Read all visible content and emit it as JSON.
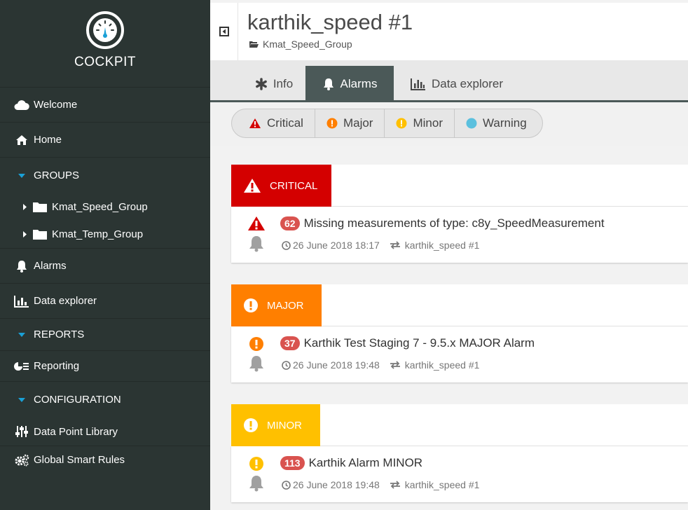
{
  "sidebar": {
    "brand": "COCKPIT",
    "items": [
      {
        "label": "Welcome",
        "icon": "cloud-icon"
      },
      {
        "label": "Home",
        "icon": "home-icon"
      },
      {
        "label": "GROUPS",
        "icon": "caret-down-icon"
      },
      {
        "label": "Kmat_Speed_Group",
        "icon": "folder-icon"
      },
      {
        "label": "Kmat_Temp_Group",
        "icon": "folder-icon"
      },
      {
        "label": "Alarms",
        "icon": "bell-icon"
      },
      {
        "label": "Data explorer",
        "icon": "bar-chart-icon"
      },
      {
        "label": "REPORTS",
        "icon": "caret-down-icon"
      },
      {
        "label": "Reporting",
        "icon": "reporting-icon"
      },
      {
        "label": "CONFIGURATION",
        "icon": "caret-down-icon"
      },
      {
        "label": "Data Point Library",
        "icon": "sliders-icon"
      },
      {
        "label": "Global Smart Rules",
        "icon": "cogs-icon"
      }
    ]
  },
  "header": {
    "title": "karthik_speed #1",
    "breadcrumb": "Kmat_Speed_Group"
  },
  "tabs": [
    {
      "label": "Info",
      "icon": "asterisk-icon"
    },
    {
      "label": "Alarms",
      "icon": "bell-icon",
      "active": true
    },
    {
      "label": "Data explorer",
      "icon": "bar-chart-icon"
    }
  ],
  "filters": [
    {
      "label": "Critical",
      "color": "#d40000"
    },
    {
      "label": "Major",
      "color": "#ff7f00"
    },
    {
      "label": "Minor",
      "color": "#ffc000"
    },
    {
      "label": "Warning",
      "color": "#5bc0de"
    }
  ],
  "groups": [
    {
      "severity": "CRITICAL",
      "color": "#d40000",
      "alarm": {
        "count": "62",
        "text": "Missing measurements of type: c8y_SpeedMeasurement",
        "time": "26 June 2018 18:17",
        "source": "karthik_speed #1"
      }
    },
    {
      "severity": "MAJOR",
      "color": "#ff7f00",
      "alarm": {
        "count": "37",
        "text": "Karthik Test Staging 7 - 9.5.x MAJOR Alarm",
        "time": "26 June 2018 19:48",
        "source": "karthik_speed #1"
      }
    },
    {
      "severity": "MINOR",
      "color": "#ffc000",
      "alarm": {
        "count": "113",
        "text": "Karthik Alarm MINOR",
        "time": "26 June 2018 19:48",
        "source": "karthik_speed #1"
      }
    }
  ]
}
